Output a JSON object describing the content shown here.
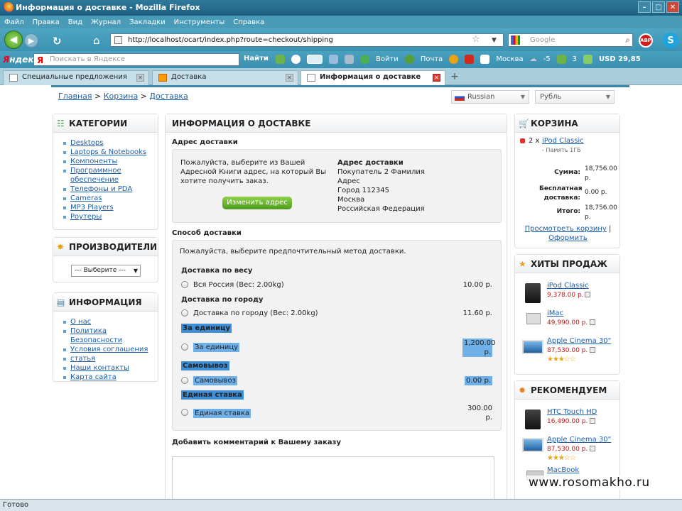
{
  "window": {
    "title": "Информация о доставке - Mozilla Firefox"
  },
  "menu": [
    "Файл",
    "Правка",
    "Вид",
    "Журнал",
    "Закладки",
    "Инструменты",
    "Справка"
  ],
  "nav": {
    "url": "http://localhost/ocart/index.php?route=checkout/shipping",
    "search_placeholder": "Google"
  },
  "yandex_bar": {
    "logo": "ндекс",
    "logo_y": "Я",
    "search_placeholder": "Поискать в Яндексе",
    "find": "Найти",
    "login": "Войти",
    "mail": "Почта",
    "city": "Москва",
    "temp": "-5",
    "count": "3",
    "currency": "USD 29,85"
  },
  "tabs": [
    {
      "label": "Специальные предложения"
    },
    {
      "label": "Доставка"
    },
    {
      "label": "Информация о доставке"
    }
  ],
  "breadcrumb": [
    "Главная",
    "Корзина",
    "Доставка"
  ],
  "language": "Russian",
  "currency": "Рубль",
  "categories": {
    "title": "КАТЕГОРИИ",
    "items": [
      "Desktops",
      "Laptops & Notebooks",
      "Компоненты",
      "Программное обеспечение",
      "Телефоны и PDA",
      "Cameras",
      "MP3 Players",
      "Роутеры"
    ]
  },
  "manufacturers": {
    "title": "ПРОИЗВОДИТЕЛИ",
    "select": "--- Выберите ---"
  },
  "information": {
    "title": "ИНФОРМАЦИЯ",
    "items": [
      "О нас",
      "Политика Безопасности",
      "Условия соглашения",
      "статья",
      "Наши контакты",
      "Карта сайта"
    ]
  },
  "main": {
    "title": "ИНФОРМАЦИЯ О ДОСТАВКЕ",
    "address_heading": "Адрес доставки",
    "address_text": "Пожалуйста, выберите из Вашей Адресной Книги адрес, на который Вы хотите получить заказ.",
    "change_button": "Изменить адрес",
    "address_label": "Адрес доставки",
    "address_lines": [
      "Покупатель 2 Фамилия",
      "Адрес",
      "Город 112345",
      "Москва",
      "Российская Федерация"
    ],
    "method_heading": "Способ доставки",
    "method_text": "Пожалуйста, выберите предпочтительный метод доставки.",
    "groups": [
      {
        "title": "Доставка по весу",
        "option": "Вся Россия (Вес: 2.00kg)",
        "price": "10.00 р."
      },
      {
        "title": "Доставка по городу",
        "option": "Доставка по городу (Вес: 2.00kg)",
        "price": "11.60 р."
      },
      {
        "title": "За единицу",
        "option": "За единицу",
        "price": "1,200.00 р."
      },
      {
        "title": "Самовывоз",
        "option": "Самовывоз",
        "price": "0.00 р."
      },
      {
        "title": "Единая ставка",
        "option": "Единая ставка",
        "price": "300.00 р."
      }
    ],
    "comment_heading": "Добавить комментарий к Вашему заказу"
  },
  "cart": {
    "title": "КОРЗИНА",
    "qty": "2 x",
    "product": "iPod Classic",
    "option": "- Память 1ГБ",
    "sum_label": "Сумма:",
    "sum_value": "18,756.00 р.",
    "free_label": "Бесплатная доставка:",
    "free_value": "0.00 р.",
    "total_label": "Итого:",
    "total_value": "18,756.00 р.",
    "view_cart": "Просмотреть корзину",
    "checkout": "Оформить"
  },
  "bestsellers": {
    "title": "ХИТЫ ПРОДАЖ",
    "items": [
      {
        "name": "iPod Classic",
        "price": "9,378.00 р."
      },
      {
        "name": "iMac",
        "price": "49,990.00 р."
      },
      {
        "name": "Apple Cinema 30\"",
        "price": "87,530.00 р.",
        "rating": 3
      }
    ]
  },
  "featured": {
    "title": "РЕКОМЕНДУЕМ",
    "items": [
      {
        "name": "HTC Touch HD",
        "price": "16,490.00 р."
      },
      {
        "name": "Apple Cinema 30\"",
        "price": "87,530.00 р.",
        "rating": 3
      },
      {
        "name": "MacBook",
        "price": ""
      }
    ]
  },
  "watermark": "www.rosomakho.ru",
  "status": "Готово"
}
